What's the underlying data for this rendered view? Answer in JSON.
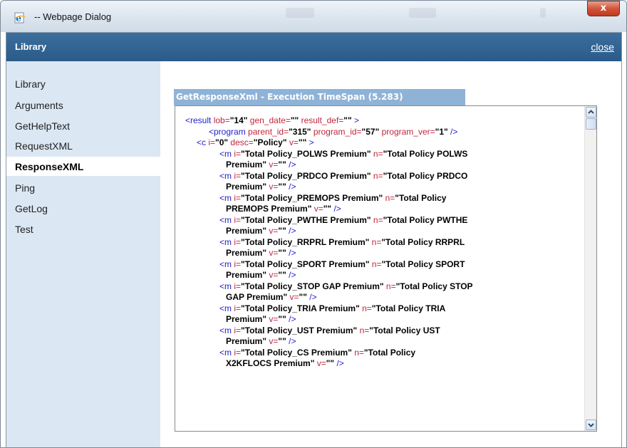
{
  "window": {
    "title": "-- Webpage Dialog",
    "close_glyph": "x",
    "icon": "ie-page-icon"
  },
  "header": {
    "title": "Library",
    "close_label": "close"
  },
  "sidebar": {
    "items": [
      {
        "label": "Library"
      },
      {
        "label": "Arguments"
      },
      {
        "label": "GetHelpText"
      },
      {
        "label": "RequestXML"
      },
      {
        "label": "ResponseXML",
        "active": true
      },
      {
        "label": "Ping"
      },
      {
        "label": "GetLog"
      },
      {
        "label": "Test"
      }
    ]
  },
  "panel": {
    "title": "GetResponseXml - Execution TimeSpan (5.283)"
  },
  "xml": {
    "result": {
      "tag": "<result",
      "lob_attr": " lob=",
      "lob": "\"14\"",
      "gen_attr": " gen_date=",
      "gen": "\"\"",
      "def_attr": " result_def=",
      "def": "\"\"",
      "close": " >"
    },
    "program": {
      "tag": "<program",
      "parent_attr": " parent_id=",
      "parent": "\"315\"",
      "pid_attr": " program_id=",
      "pid": "\"57\"",
      "ver_attr": " program_ver=",
      "ver": "\"1\"",
      "close": " />"
    },
    "c": {
      "tag": "<c",
      "i_attr": " i=",
      "i": "\"0\"",
      "desc_attr": "  desc=",
      "desc": "\"Policy\"",
      "v_attr": "  v=",
      "v": "\"\"",
      "close": " >"
    },
    "m_items": [
      {
        "i": "\"Total Policy_POLWS Premium\"",
        "n1": "\"Total Policy POLWS",
        "n2": "Premium\""
      },
      {
        "i": "\"Total Policy_PRDCO Premium\"",
        "n1": "\"Total Policy PRDCO",
        "n2": "Premium\""
      },
      {
        "i": "\"Total Policy_PREMOPS Premium\"",
        "n1": "\"Total Policy",
        "n2": "PREMOPS Premium\""
      },
      {
        "i": "\"Total Policy_PWTHE Premium\"",
        "n1": "\"Total Policy PWTHE",
        "n2": "Premium\""
      },
      {
        "i": "\"Total Policy_RRPRL Premium\"",
        "n1": "\"Total Policy RRPRL",
        "n2": "Premium\""
      },
      {
        "i": "\"Total Policy_SPORT Premium\"",
        "n1": "\"Total Policy SPORT",
        "n2": "Premium\""
      },
      {
        "i": "\"Total Policy_STOP GAP Premium\"",
        "n1": "\"Total Policy STOP",
        "n2": "GAP Premium\""
      },
      {
        "i": "\"Total Policy_TRIA Premium\"",
        "n1": "\"Total Policy TRIA",
        "n2": "Premium\""
      },
      {
        "i": "\"Total Policy_UST Premium\"",
        "n1": "\"Total Policy UST",
        "n2": "Premium\""
      },
      {
        "i": "\"Total Policy_CS Premium\"",
        "n1": "\"Total Policy",
        "n2": "X2KFLOCS Premium\""
      }
    ],
    "m_tag": "<m",
    "m_i_attr": " i=",
    "m_n_attr": " n=",
    "m_v_attr": "  v=",
    "m_v": "\"\"",
    "m_close": " />"
  }
}
